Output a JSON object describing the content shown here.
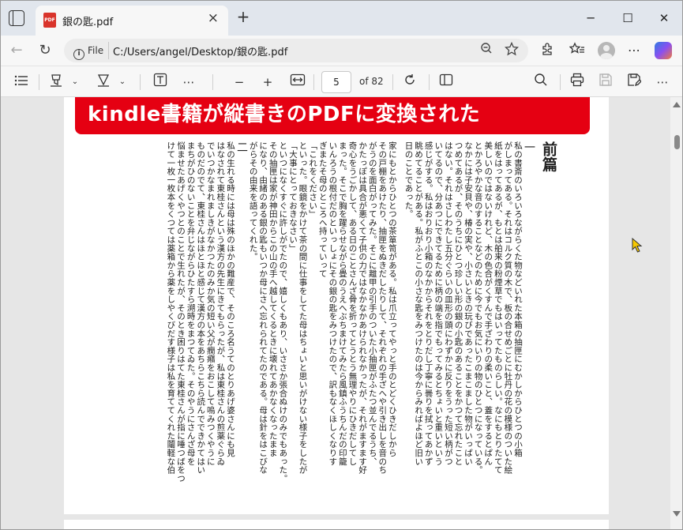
{
  "tab": {
    "title": "銀の匙.pdf",
    "pdf_badge": "PDF",
    "close": "×",
    "new_tab": "+"
  },
  "window_controls": {
    "minimize": "─",
    "maximize": "☐",
    "close": "✕"
  },
  "address": {
    "file_label": "File",
    "info": "i",
    "url": "C:/Users/angel/Desktop/銀の匙.pdf"
  },
  "nav": {
    "back": "←",
    "refresh": "↻"
  },
  "pdf_toolbar": {
    "page": "5",
    "of_pages": "of 82",
    "zoom_out": "−",
    "zoom_in": "+",
    "more": "⋯"
  },
  "banner": "kindle書籍が縦書きのPDFに変換された",
  "book": {
    "heading": "前篇",
    "section1": "一",
    "section2": "二",
    "columns1": [
      "私の書斎のいろいろながらくた物などいれた本箱の抽匣にむかしからひとつの小箱",
      "がしまってある。それはコルク質の木で、板の合せめごとに牡丹の花の模様のついた絵",
      "紙をはってあるが、もとは舶来の粉煙草でもはいってたものらしい。なにもとりたてて",
      "美しいのではないけれど、木の色合がくすんで手ざわりの柔いこと、蓋をするとぱん",
      "とかろやかな音のすることなどのために今でもお気にいりの物のひとつになっている。",
      "なかには子安貝や、椿の実や、小さいときの玩びであったこまこました物がいっぱい",
      "つめてあるが、そのうちにひとつ珍しい形の銀の小匙のあることをかつて忘れたこと",
      "はない。それはさしわたし五分ぐらいの皿形の頭にわずかに反りをうった短い柄がつ",
      "いてるので、分あつにできてるために柄の端を指でもってみるとちょいと重いという",
      "感じがする。私はおりおり小箱のなかからそれをとりだし丁寧に曇りを拭ってあかず",
      "眺めてることがある。私がふとこの小さな匙をみつけたのは今からみればよほど旧い",
      "日のことであった。"
    ],
    "columns2": [
      "家にもとからひとつの茶箪笥がある。私は爪立ってやっと手のとどくひきだしから",
      "その戸棚をあけたり、抽匣をぬきだしたりして、それぞれの手ざへや引き出しを音のち",
      "がうのを面白がってみた。そこに離甲の引手のついた小抽匣がふたつ並んでるうち、",
      "かたっぽは具合が悪くて子供の力ではなかなかあけられなかったが、それがますます好",
      "奇心をうごかして、ある日のことさんざ骨を折ってとうとう無理やりにひきだしてし",
      "まった。そこで胸を躍らせながら畳のうえへぶちまけてみたら風鎮ふうちんだの印籠",
      "いんろうの根付だのといっしょにその銀の匙をみつけたので、訳もなくほしくなりす",
      "ぎまたそ母のところへ持っていって",
      "「これをください」",
      "といった。眼鏡をかけて茶の間に仕事をしてた母はちょいと思いがけない様子をしたが",
      "「大事にとっておきなさい」",
      "といつになくすぐに許しがでたので、嬉しくもあり、いささか張合ぬけのみでもあった。",
      "その抽匣は家が神田からこの山の手へ越してくるときに壊れてあかなくなったまま",
      "になり、由緒のある銀の匙もいつか母にさへ忘れられてたのである。母は針をはこびな",
      "がらその由来を語ってくれた。"
    ],
    "columns3": [
      "私の生れる時には母は殊のほかの難産で、そのころ名うてのとりあげ婆さんにも見",
      "はなされて東桂さんという漢方の先生にきてもらったが、私は東桂さんの煎薬ぐらゐ",
      "でいつかなまれましきがなかつたのみか気の短い父が癇癪をおこして嗚みつくやうに",
      "ものだのでて、東桂さんはほとほと感じて漢方の本をあちらこちら読んでできかてはい",
      "まちがひのないことを弁じながらひたすら溯時をまつてゐた。そのやうにさんざ母を",
      "悩ませたあげくやつとのことで生れたが、そのとき困りはてた東桂さんが指に唾つばをつ",
      "けて一枚一枚本をくつては薬箱から薬をしやくびだす様子は私を育ててくれた鬮軽な伯"
    ]
  }
}
